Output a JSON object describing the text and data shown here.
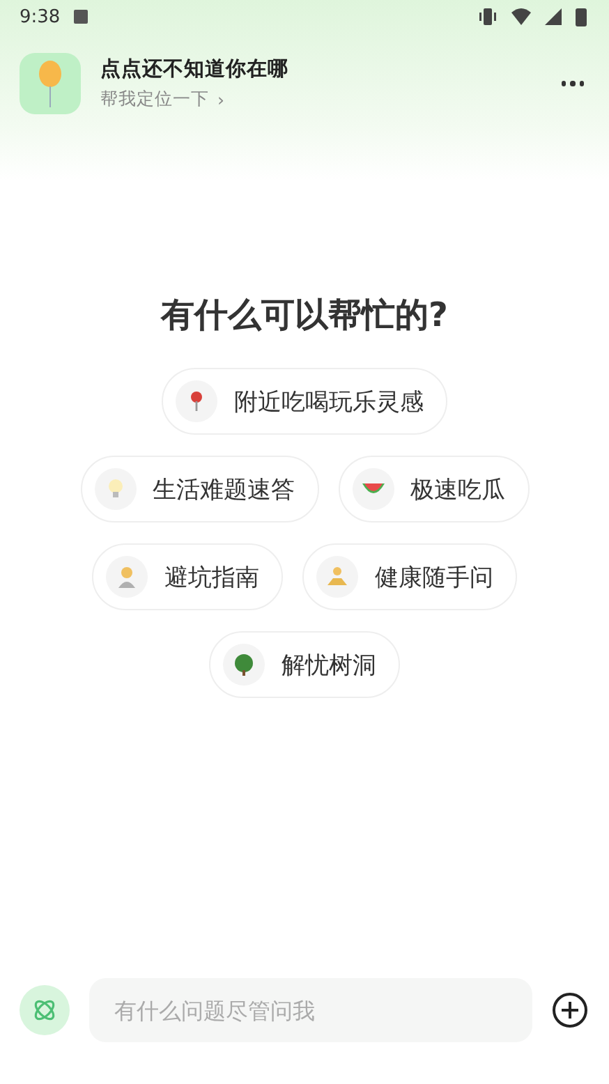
{
  "status_bar": {
    "time": "9:38"
  },
  "header": {
    "title": "点点还不知道你在哪",
    "subtitle": "帮我定位一下",
    "chevron": "›"
  },
  "heading": "有什么可以帮忙的?",
  "suggestion_rows": [
    {
      "chips": [
        {
          "label": "附近吃喝玩乐灵感"
        }
      ]
    },
    {
      "chips": [
        {
          "label": "生活难题速答"
        },
        {
          "label": "极速吃瓜"
        }
      ]
    },
    {
      "chips": [
        {
          "label": "避坑指南"
        },
        {
          "label": "健康随手问"
        }
      ]
    },
    {
      "chips": [
        {
          "label": "解忧树洞"
        }
      ]
    }
  ],
  "input": {
    "placeholder": "有什么问题尽管问我"
  }
}
